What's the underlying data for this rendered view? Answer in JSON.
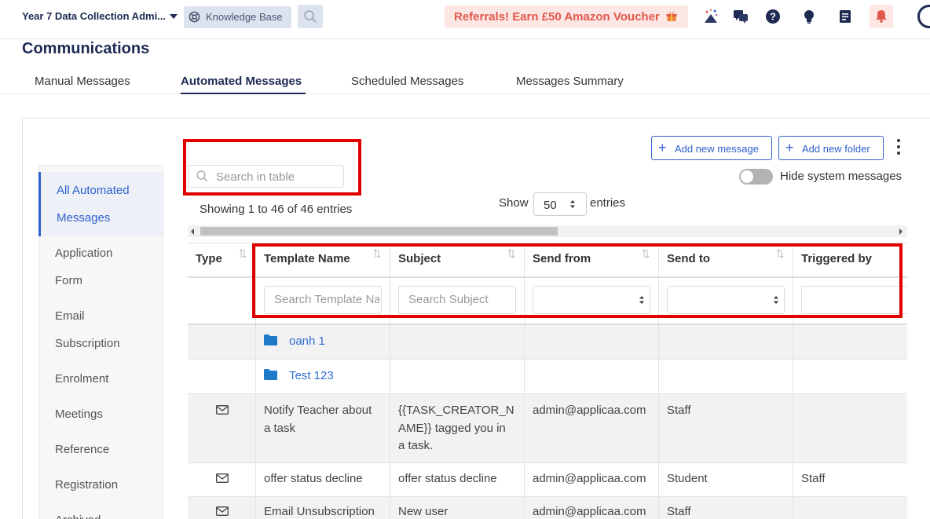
{
  "topbar": {
    "app_title": "Year 7 Data Collection Admi...",
    "knowledge_base": "Knowledge Base",
    "referral": "Referrals! Earn £50 Amazon Voucher"
  },
  "page": {
    "title": "Communications",
    "tabs": [
      {
        "label": "Manual Messages"
      },
      {
        "label": "Automated Messages"
      },
      {
        "label": "Scheduled Messages"
      },
      {
        "label": "Messages Summary"
      }
    ]
  },
  "sidebar": {
    "items": [
      {
        "line1": "All Automated",
        "line2": "Messages"
      },
      {
        "line1": "Application",
        "line2": "Form"
      },
      {
        "line1": "Email",
        "line2": "Subscription"
      },
      {
        "line1": "Enrolment"
      },
      {
        "line1": "Meetings"
      },
      {
        "line1": "Reference"
      },
      {
        "line1": "Registration"
      },
      {
        "line1": "Archived"
      }
    ]
  },
  "controls": {
    "search_placeholder": "Search in table",
    "showing": "Showing 1 to 46 of 46 entries",
    "show_label": "Show",
    "show_value": "50",
    "entries_label": "entries",
    "add_message": "Add new message",
    "add_folder": "Add new folder",
    "hide_system": "Hide system messages"
  },
  "table": {
    "headers": [
      "Type",
      "Template Name",
      "Subject",
      "Send from",
      "Send to",
      "Triggered by"
    ],
    "filters": {
      "template_placeholder": "Search Template Name",
      "subject_placeholder": "Search Subject"
    },
    "folders": [
      {
        "name": "oanh 1"
      },
      {
        "name": "Test 123"
      }
    ],
    "rows": [
      {
        "name_l1": "Notify Teacher about",
        "name_l2": "a task",
        "subj_l1": "{{TASK_CREATOR_N",
        "subj_l2": "AME}} tagged you in",
        "subj_l3": "a task.",
        "from": "admin@applicaa.com",
        "to": "Staff",
        "trigger": ""
      },
      {
        "name_l1": "offer status decline",
        "subj_l1": "offer status decline",
        "from": "admin@applicaa.com",
        "to": "Student",
        "trigger": "Staff"
      },
      {
        "name_l1": "Email Unsubscription",
        "subj_l1": "New user",
        "from": "admin@applicaa.com",
        "to": "Staff",
        "trigger": ""
      }
    ]
  },
  "colors": {
    "brand": "#1e2a52",
    "accent": "#2f5fcf",
    "highlight_box": "#e00000"
  }
}
